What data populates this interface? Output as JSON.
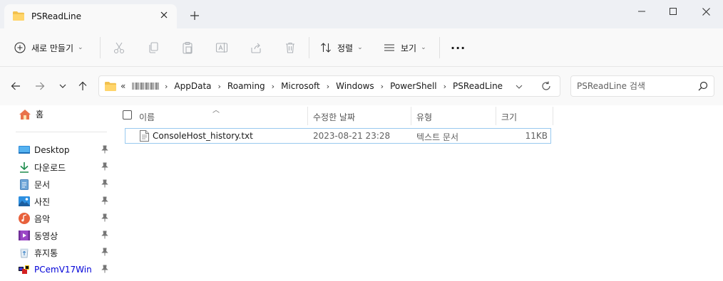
{
  "window": {
    "tab_title": "PSReadLine",
    "tab_close_icon": "close-icon",
    "new_tab_icon": "plus-icon"
  },
  "toolbar": {
    "new_label": "새로 만들기",
    "sort_label": "정렬",
    "view_label": "보기",
    "more_label": "···"
  },
  "address": {
    "overflow": "«",
    "breadcrumbs": [
      "AppData",
      "Roaming",
      "Microsoft",
      "Windows",
      "PowerShell",
      "PSReadLine"
    ],
    "breadcrumb_separator": "›"
  },
  "search": {
    "placeholder": "PSReadLine 검색"
  },
  "sidebar": {
    "home_label": "홈",
    "items": [
      {
        "label": "Desktop",
        "icon": "desktop-icon"
      },
      {
        "label": "다운로드",
        "icon": "download-icon"
      },
      {
        "label": "문서",
        "icon": "document-icon"
      },
      {
        "label": "사진",
        "icon": "pictures-icon"
      },
      {
        "label": "음악",
        "icon": "music-icon"
      },
      {
        "label": "동영상",
        "icon": "video-icon"
      },
      {
        "label": "휴지통",
        "icon": "recycle-bin-icon"
      },
      {
        "label": "PCemV17Win",
        "icon": "app-folder-icon"
      }
    ]
  },
  "columns": {
    "name": "이름",
    "modified": "수정한 날짜",
    "type": "유형",
    "size": "크기"
  },
  "files": [
    {
      "name": "ConsoleHost_history.txt",
      "modified": "2023-08-21 23:28",
      "type": "텍스트 문서",
      "size": "11KB"
    }
  ],
  "colors": {
    "folder": "#f2c14e",
    "accent": "#0067c0",
    "selection_border": "#99c9ef"
  }
}
